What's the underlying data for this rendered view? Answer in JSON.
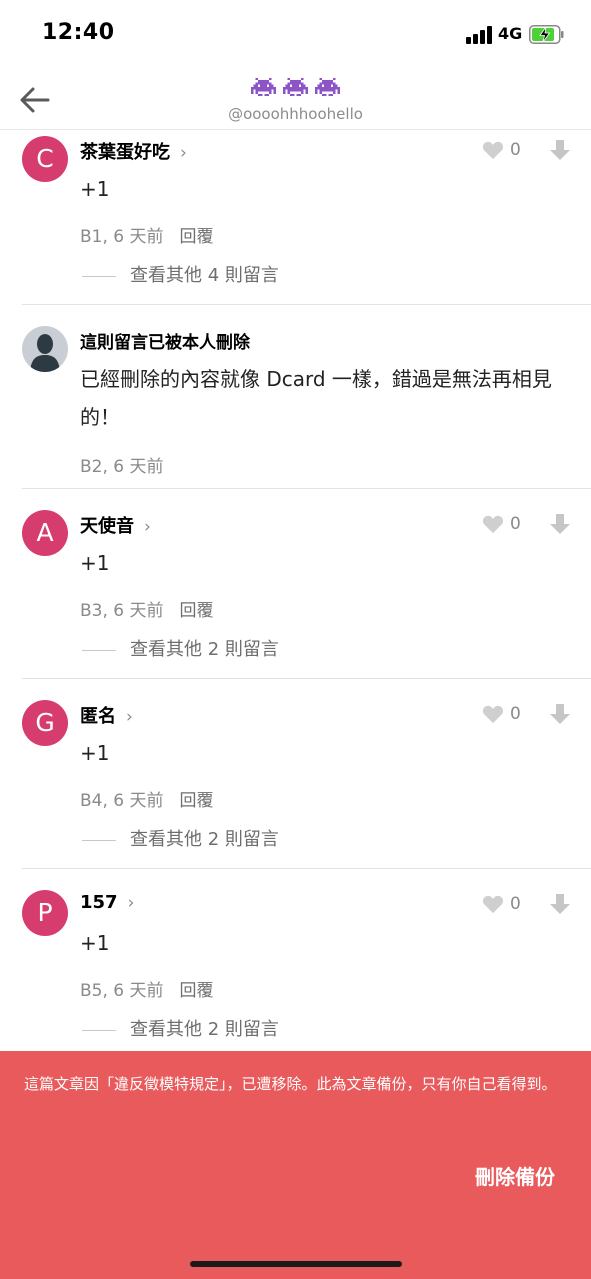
{
  "status_bar": {
    "time": "12:40",
    "network": "4G"
  },
  "header": {
    "title_icons": [
      "alien-monster-icon",
      "alien-monster-icon",
      "alien-monster-icon"
    ],
    "handle": "@oooohhhoohello"
  },
  "comments": [
    {
      "avatar": "C",
      "name": "茶葉蛋好吃",
      "body": "+1",
      "floor": "B1, 6 天前",
      "reply": "回覆",
      "likes": "0",
      "more": "查看其他 4 則留言"
    },
    {
      "avatar": "",
      "name": "這則留言已被本人刪除",
      "body": "已經刪除的內容就像 Dcard 一樣，錯過是無法再相見的！",
      "floor": "B2, 6 天前"
    },
    {
      "avatar": "A",
      "name": "天使音",
      "body": "+1",
      "floor": "B3, 6 天前",
      "reply": "回覆",
      "likes": "0",
      "more": "查看其他 2 則留言"
    },
    {
      "avatar": "G",
      "name": "匿名",
      "body": "+1",
      "floor": "B4, 6 天前",
      "reply": "回覆",
      "likes": "0",
      "more": "查看其他 2 則留言"
    },
    {
      "avatar": "P",
      "name": "157",
      "body": "+1",
      "floor": "B5, 6 天前",
      "reply": "回覆",
      "likes": "0",
      "more": "查看其他 2 則留言"
    }
  ],
  "banner": {
    "message": "這篇文章因「違反徵模特規定」，已遭移除。此為文章備份，只有你自己看得到。",
    "action": "刪除備份"
  },
  "colors": {
    "avatar": "#d63c6d",
    "banner": "#e95a5c"
  }
}
